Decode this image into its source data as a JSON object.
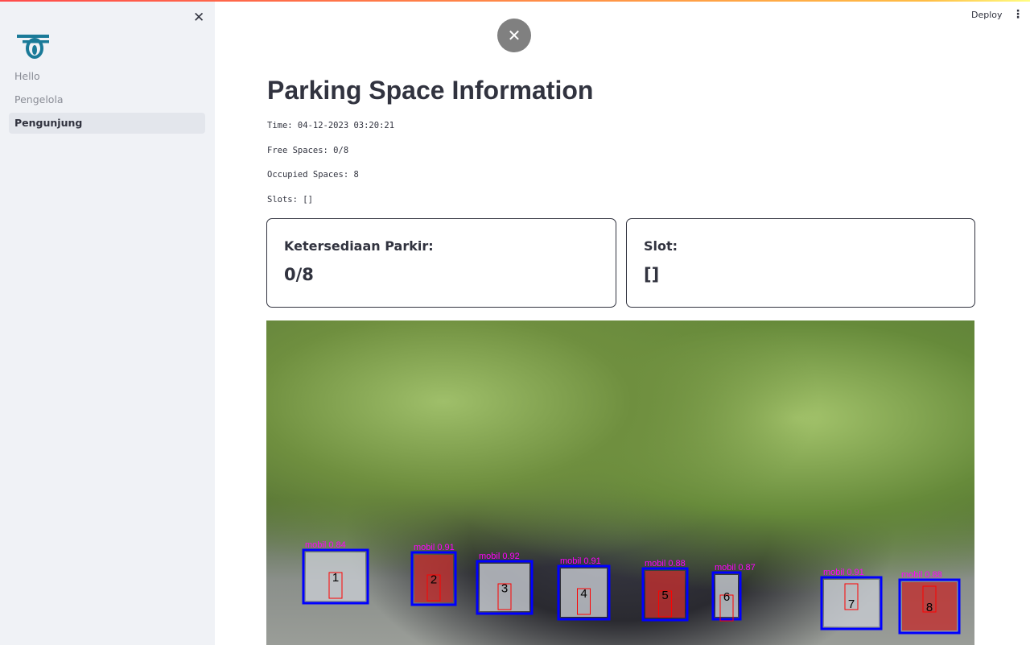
{
  "sidebar": {
    "items": [
      {
        "label": "Hello"
      },
      {
        "label": "Pengelola"
      },
      {
        "label": "Pengunjung"
      }
    ],
    "active": "Pengunjung"
  },
  "header": {
    "deploy": "Deploy"
  },
  "main": {
    "title": "Parking Space Information",
    "time": "Time: 04-12-2023 03:20:21",
    "free": "Free Spaces: 0/8",
    "occupied": "Occupied Spaces: 8",
    "slots": "Slots: []",
    "cards": [
      {
        "title": "Ketersediaan Parkir:",
        "value": "0/8"
      },
      {
        "title": "Slot:",
        "value": "[]"
      }
    ],
    "detections": [
      {
        "slot": "1",
        "label": "mobil 0.84"
      },
      {
        "slot": "2",
        "label": "mobil 0.91"
      },
      {
        "slot": "3",
        "label": "mobil 0.92"
      },
      {
        "slot": "4",
        "label": "mobil 0.91"
      },
      {
        "slot": "5",
        "label": "mobil 0.88"
      },
      {
        "slot": "6",
        "label": "mobil 0.87"
      },
      {
        "slot": "7",
        "label": "mobil 0.91"
      },
      {
        "slot": "8",
        "label": "mobil 0.88"
      }
    ]
  },
  "colors": {
    "accent": "#ff4b4b",
    "box": "#0000ff",
    "label": "#ff00ff",
    "marker": "#ff0000"
  }
}
